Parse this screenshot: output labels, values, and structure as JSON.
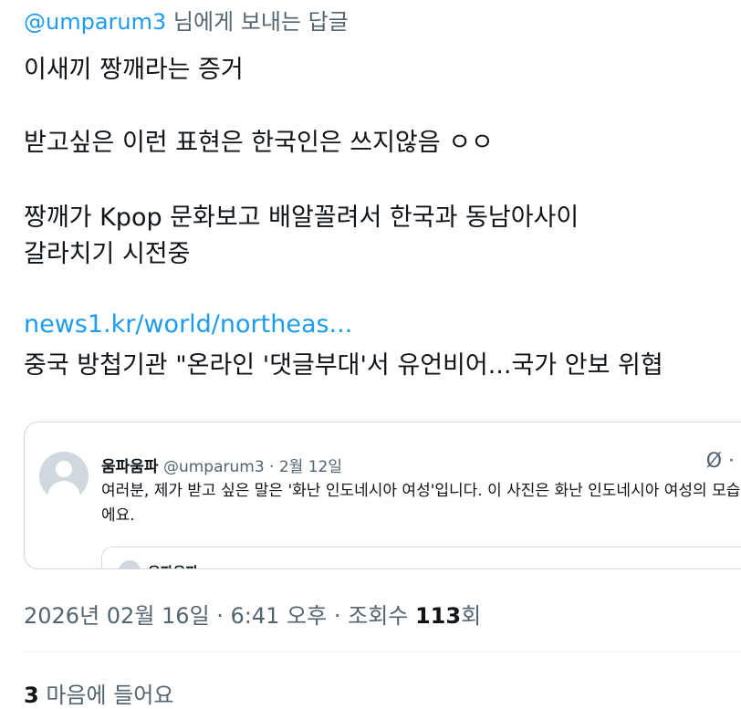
{
  "reply": {
    "mention": "@umparum3",
    "suffix": " 님에게 보내는 답글"
  },
  "post": {
    "line1": "이새끼 짱깨라는 증거",
    "line2": "받고싶은 이런 표현은 한국인은 쓰지않음 ㅇㅇ",
    "line3": "짱깨가 Kpop 문화보고 배알꼴려서  한국과 동남아사이",
    "line4": "갈라치기 시전중",
    "link": "news1.kr/world/northeas...",
    "card_title": "중국 방첩기관 \"온라인 '댓글부대'서 유언비어...국가 안보 위협"
  },
  "quote": {
    "name": "움파움파",
    "meta": " @umparum3 · 2월 12일",
    "icon": "Ø ·",
    "text": "여러분, 제가 받고 싶은 말은 '화난 인도네시아 여성'입니다. 이 사진은 화난 인도네시아 여성의 모습이에요.",
    "inner_name": "움파움파"
  },
  "meta": {
    "timestamp": "2026년 02월 16일 · 6:41 오후 · 조회수 ",
    "views": "113",
    "views_suffix": "회"
  },
  "likes": {
    "count": "3",
    "label": " 마음에 들어요"
  }
}
